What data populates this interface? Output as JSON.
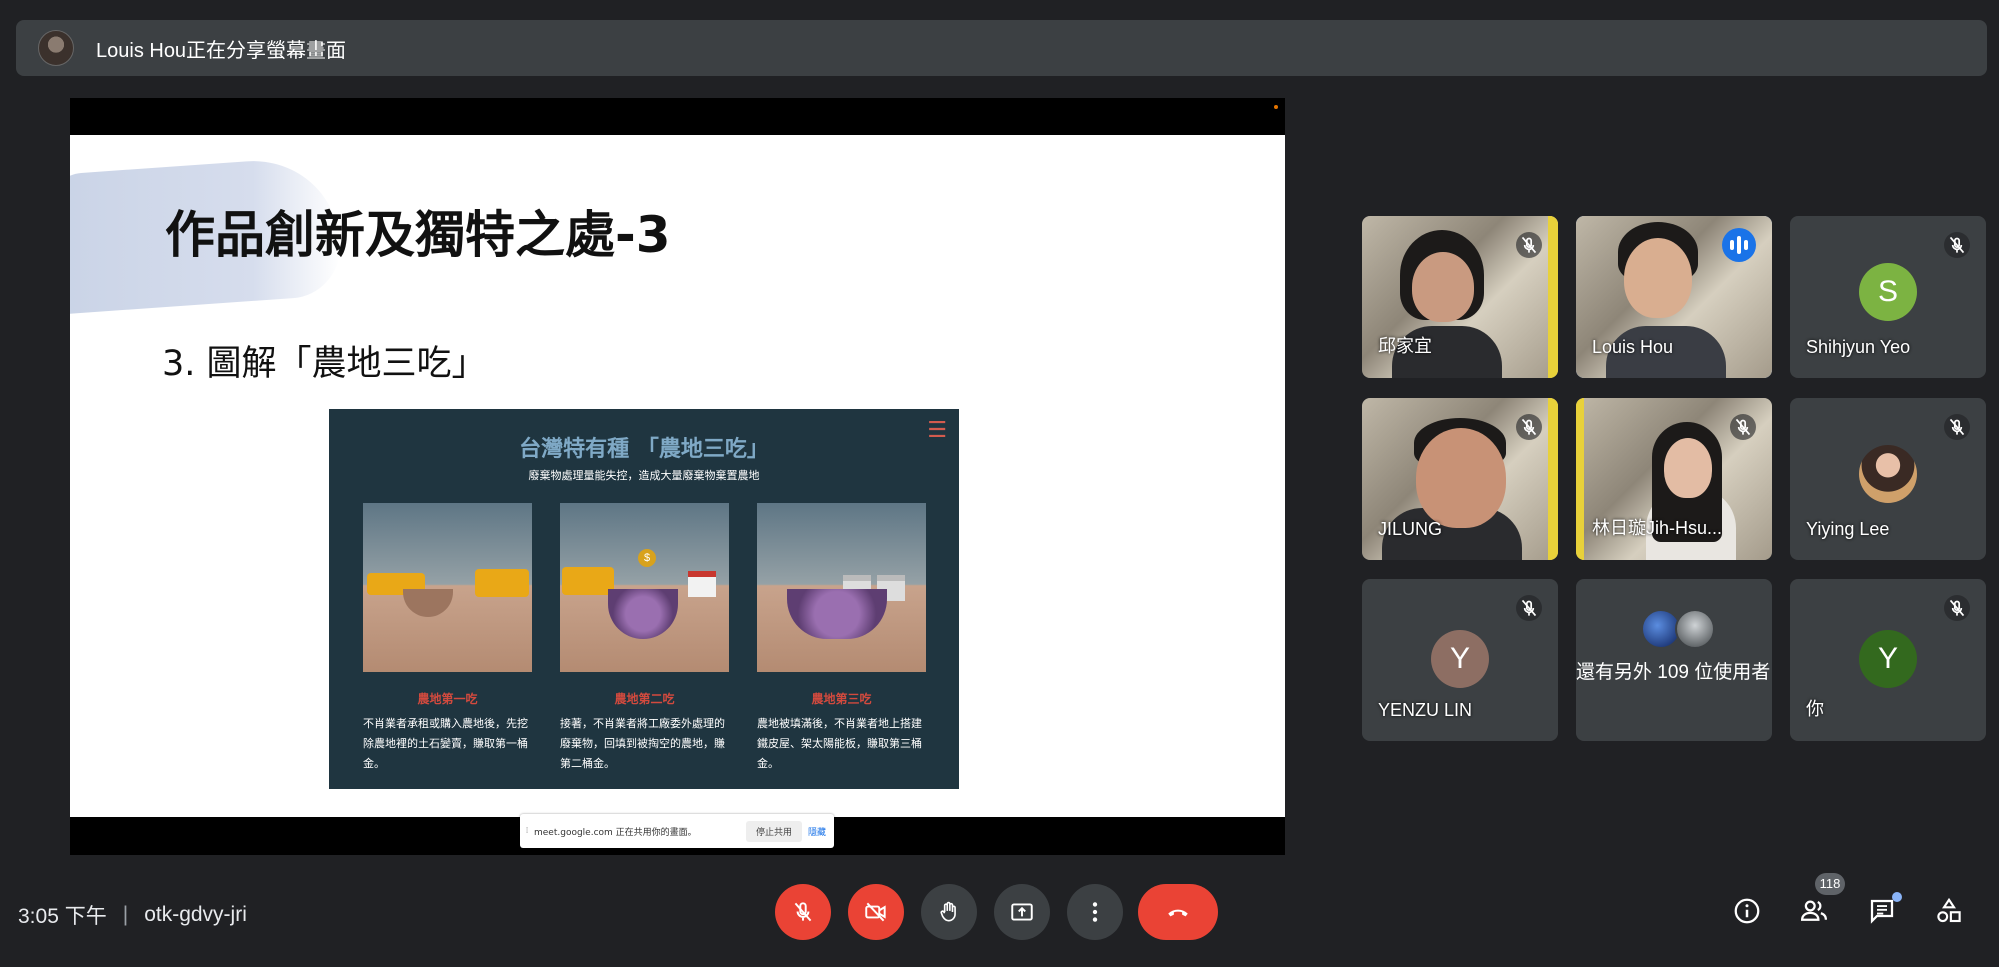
{
  "topbar": {
    "presenter_text": "Louis Hou正在分享螢幕畫面"
  },
  "slide": {
    "title": "作品創新及獨特之處-3",
    "subtitle": "3. 圖解「農地三吃」",
    "infographic": {
      "title": "台灣特有種 「農地三吃」",
      "subtitle": "廢棄物處理量能失控，造成大量廢棄物棄置農地",
      "coin_symbol": "$",
      "panels": [
        {
          "label": "農地第一吃",
          "desc": "不肖業者承租或購入農地後，先挖除農地裡的土石變賣，賺取第一桶金。"
        },
        {
          "label": "農地第二吃",
          "desc": "接著，不肖業者將工廠委外處理的廢棄物，回填到被掏空的農地，賺第二桶金。"
        },
        {
          "label": "農地第三吃",
          "desc": "農地被填滿後，不肖業者地上搭建鐵皮屋、架太陽能板，賺取第三桶金。"
        }
      ]
    }
  },
  "share_banner": {
    "text": "meet.google.com 正在共用你的畫面。",
    "stop": "停止共用",
    "hide": "隱藏"
  },
  "participants": [
    {
      "name": "邱家宜"
    },
    {
      "name": "Louis Hou"
    },
    {
      "name": "Shihjyun Yeo",
      "initial": "S",
      "color": "#7cb342"
    },
    {
      "name": "JILUNG"
    },
    {
      "name": "林日璇Jih-Hsu..."
    },
    {
      "name": "Yiying Lee"
    },
    {
      "name": "YENZU LIN",
      "initial": "Y",
      "color": "#8d6e63"
    },
    {
      "name": "你",
      "initial": "Y",
      "color": "#33691e"
    }
  ],
  "others": {
    "text": "還有另外 109 位使用者"
  },
  "meeting": {
    "time": "3:05 下午",
    "code": "otk-gdvy-jri"
  },
  "people_count": "118",
  "icons": {
    "controls": [
      "mic-off-icon",
      "camera-off-icon",
      "raise-hand-icon",
      "present-icon",
      "more-options-icon",
      "end-call-icon"
    ],
    "right": [
      "info-icon",
      "people-icon",
      "chat-icon",
      "activities-icon"
    ]
  },
  "colors": {
    "background": "#202124",
    "end_call": "#ea4335",
    "accent": "#8ab4f8"
  }
}
